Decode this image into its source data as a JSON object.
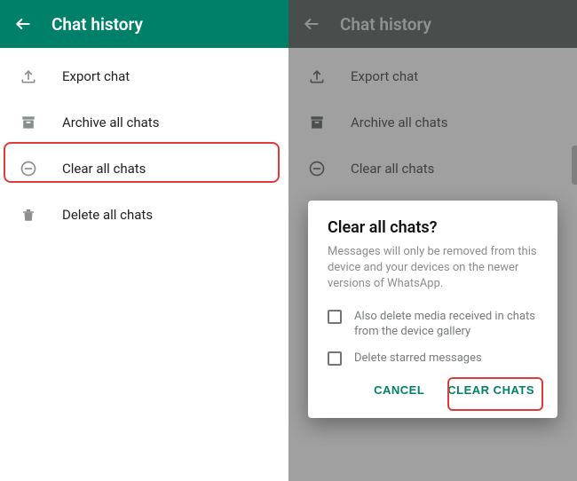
{
  "header": {
    "back_icon": "arrow-left",
    "title": "Chat history"
  },
  "menu": {
    "items": [
      {
        "name": "export-chat",
        "label": "Export chat",
        "icon": "upload"
      },
      {
        "name": "archive-all-chats",
        "label": "Archive all chats",
        "icon": "archive"
      },
      {
        "name": "clear-all-chats",
        "label": "Clear all chats",
        "icon": "clear"
      },
      {
        "name": "delete-all-chats",
        "label": "Delete all chats",
        "icon": "trash"
      }
    ]
  },
  "dialog": {
    "title": "Clear all chats?",
    "body": "Messages will only be removed from this device and your devices on the newer versions of WhatsApp.",
    "options": [
      {
        "name": "delete-media",
        "label": "Also delete media received in chats from the device gallery",
        "checked": false
      },
      {
        "name": "delete-starred",
        "label": "Delete starred messages",
        "checked": false
      }
    ],
    "cancel_label": "CANCEL",
    "confirm_label": "CLEAR CHATS"
  },
  "colors": {
    "brand": "#008069",
    "highlight": "#e03b3b"
  }
}
